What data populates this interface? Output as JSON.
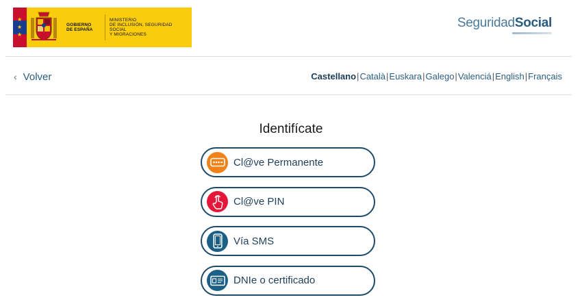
{
  "header": {
    "gov_line1": "Gobierno",
    "gov_line2": "de España",
    "ministry_line1": "Ministerio",
    "ministry_line2": "de Inclusión, Seguridad Social",
    "ministry_line3": "y Migraciones",
    "logo_light": "Seguridad",
    "logo_bold": "Social"
  },
  "nav": {
    "back_label": "Volver",
    "languages": [
      {
        "label": "Castellano",
        "active": true
      },
      {
        "label": "Català"
      },
      {
        "label": "Euskara"
      },
      {
        "label": "Galego"
      },
      {
        "label": "Valenciá"
      },
      {
        "label": "English"
      },
      {
        "label": "Français"
      }
    ]
  },
  "main": {
    "title": "Identifícate",
    "options": [
      {
        "label": "Cl@ve Permanente",
        "icon": "password-dots-icon",
        "color": "#f08218"
      },
      {
        "label": "Cl@ve PIN",
        "icon": "pin-touch-icon",
        "color": "#e4173a"
      },
      {
        "label": "Vía SMS",
        "icon": "mobile-phone-icon",
        "color": "#1b5f86"
      },
      {
        "label": "DNIe o certificado",
        "icon": "id-card-icon",
        "color": "#1b5f86"
      }
    ]
  },
  "colors": {
    "banner_yellow": "#f9cd0c",
    "accent_navy": "#1d4a68"
  }
}
